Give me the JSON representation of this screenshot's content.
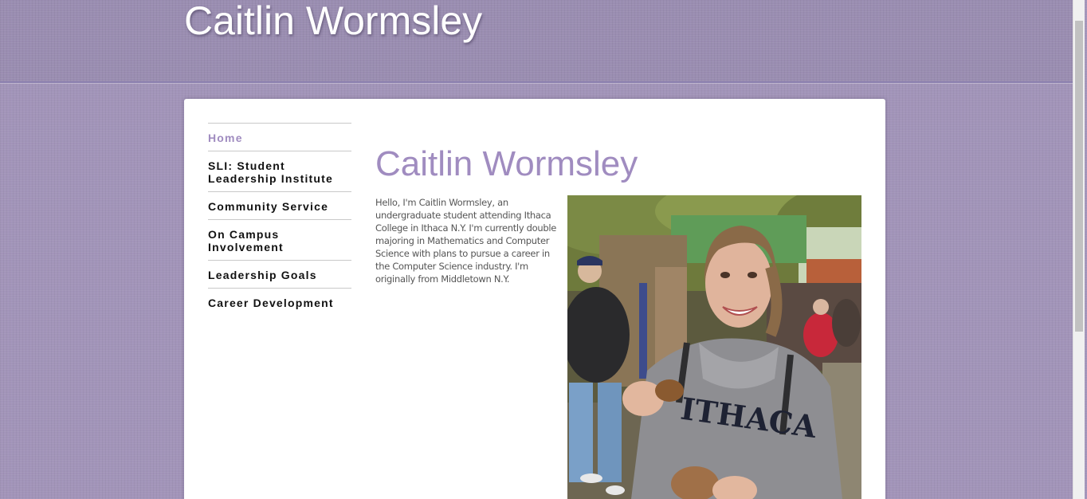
{
  "site": {
    "title": "Caitlin Wormsley"
  },
  "nav": {
    "items": [
      {
        "label": "Home",
        "active": true
      },
      {
        "label": "SLI: Student Leadership Institute",
        "active": false
      },
      {
        "label": "Community Service",
        "active": false
      },
      {
        "label": "On Campus Involvement",
        "active": false
      },
      {
        "label": "Leadership Goals",
        "active": false
      },
      {
        "label": "Career Development",
        "active": false
      }
    ]
  },
  "main": {
    "heading": "Caitlin Wormsley",
    "intro": "Hello, I'm Caitlin Wormsley, an undergraduate student attending Ithaca College in Ithaca N.Y. I'm currently double majoring in Mathematics and Computer Science with plans to pursue a career in the Computer Science industry. I'm originally from Middletown N.Y.",
    "photo": {
      "sweatshirt_text": "ITHACA"
    }
  },
  "colors": {
    "accent": "#a08cc0",
    "background": "#a294b9",
    "nav_text": "#111111"
  }
}
